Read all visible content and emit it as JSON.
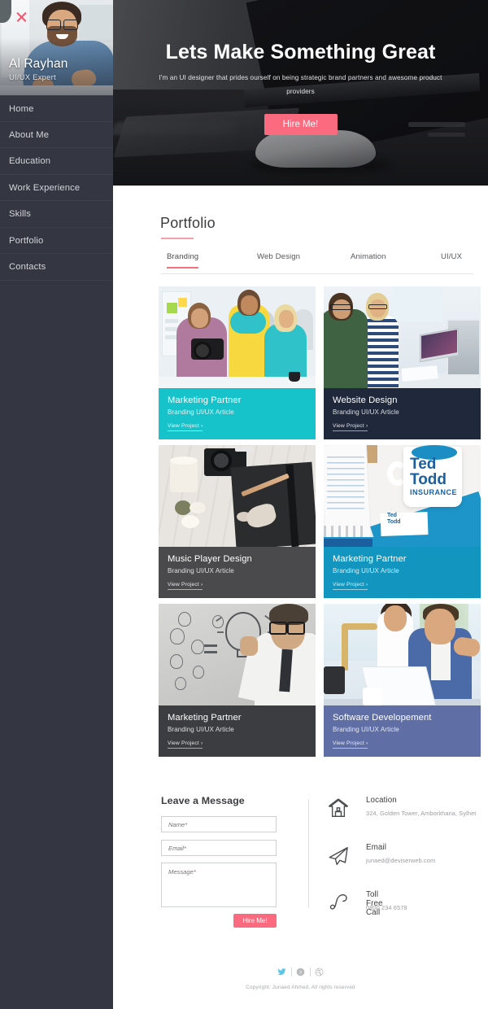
{
  "sidebar": {
    "close_icon": "close-x-icon",
    "profile": {
      "name": "Al Rayhan",
      "role": "UI/UX Expert",
      "photo_alt": "bearded-man-with-glasses-denim-shirt"
    },
    "nav_items": [
      {
        "label": "Home"
      },
      {
        "label": "About Me"
      },
      {
        "label": "Education"
      },
      {
        "label": "Work Experience"
      },
      {
        "label": "Skills"
      },
      {
        "label": "Portfolio"
      },
      {
        "label": "Contacts"
      }
    ]
  },
  "hero": {
    "title": "Lets Make Something Great",
    "subtitle": "I'm an UI designer that prides ourself on being strategic brand partners and awesome product providers",
    "cta_label": "Hire Me!",
    "background_alt": "grayscale-laptop-and-mouse-on-desk"
  },
  "portfolio": {
    "heading": "Portfolio",
    "tabs": [
      {
        "label": "Branding",
        "active": true
      },
      {
        "label": "Web Design",
        "active": false
      },
      {
        "label": "Animation",
        "active": false
      },
      {
        "label": "UI/UX",
        "active": false
      }
    ],
    "cards": [
      {
        "title": "Marketing Partner",
        "subtitle": "Branding UI/UX Article",
        "link_label": "View Project  ›",
        "caption_color": "#17c3cb",
        "image_alt": "three-coworkers-with-camera-in-office"
      },
      {
        "title": "Website Design",
        "subtitle": "Branding UI/UX Article",
        "link_label": "View Project  ›",
        "caption_color": "#20293b",
        "image_alt": "two-students-working-at-computers"
      },
      {
        "title": "Music Player Design",
        "subtitle": "Branding UI/UX Article",
        "link_label": "View Project  ›",
        "caption_color": "#4a4a4c",
        "image_alt": "flatlay-camera-notebook-pencil-candle"
      },
      {
        "title": "Marketing Partner",
        "subtitle": "Branding UI/UX Article",
        "link_label": "View Project  ›",
        "caption_color": "#1295bf",
        "image_alt": "ted-todd-insurance-branded-mug-and-stationery"
      },
      {
        "title": "Marketing Partner",
        "subtitle": "Branding UI/UX Article",
        "link_label": "View Project  ›",
        "caption_color": "#3c3d41",
        "image_alt": "man-with-glasses-drawing-lightbulb-idea"
      },
      {
        "title": "Software Developement",
        "subtitle": "Branding UI/UX Article",
        "link_label": "View Project  ›",
        "caption_color": "#5f6fa5",
        "image_alt": "couple-looking-at-laptop-together"
      }
    ]
  },
  "contact": {
    "form_heading": "Leave a Message",
    "fields": {
      "name_placeholder": "Name*",
      "email_placeholder": "Email*",
      "message_placeholder": "Message*"
    },
    "submit_label": "Hire Me!",
    "info": [
      {
        "icon": "home-icon",
        "label": "Location",
        "value": "324, Golden Tower, Amborkhana, Sylhet"
      },
      {
        "icon": "paper-plane-icon",
        "label": "Email",
        "value": "junaed@deviserweb.com"
      },
      {
        "icon": "phone-icon",
        "label": "Toll Free Call",
        "value": "0800 234 6578"
      }
    ]
  },
  "footer": {
    "socials": [
      {
        "icon": "twitter-icon",
        "color": "#5bc8e8"
      },
      {
        "icon": "skype-icon",
        "color": "#b9babd"
      },
      {
        "icon": "dribbble-icon",
        "color": "#b9babd"
      }
    ],
    "copyright": "Copyright: Junaed Ahmed, All rights reserved"
  },
  "theme": {
    "accent": "#fa6b7f",
    "sidebar_bg": "#343641",
    "rule": "#f5a1ac"
  }
}
